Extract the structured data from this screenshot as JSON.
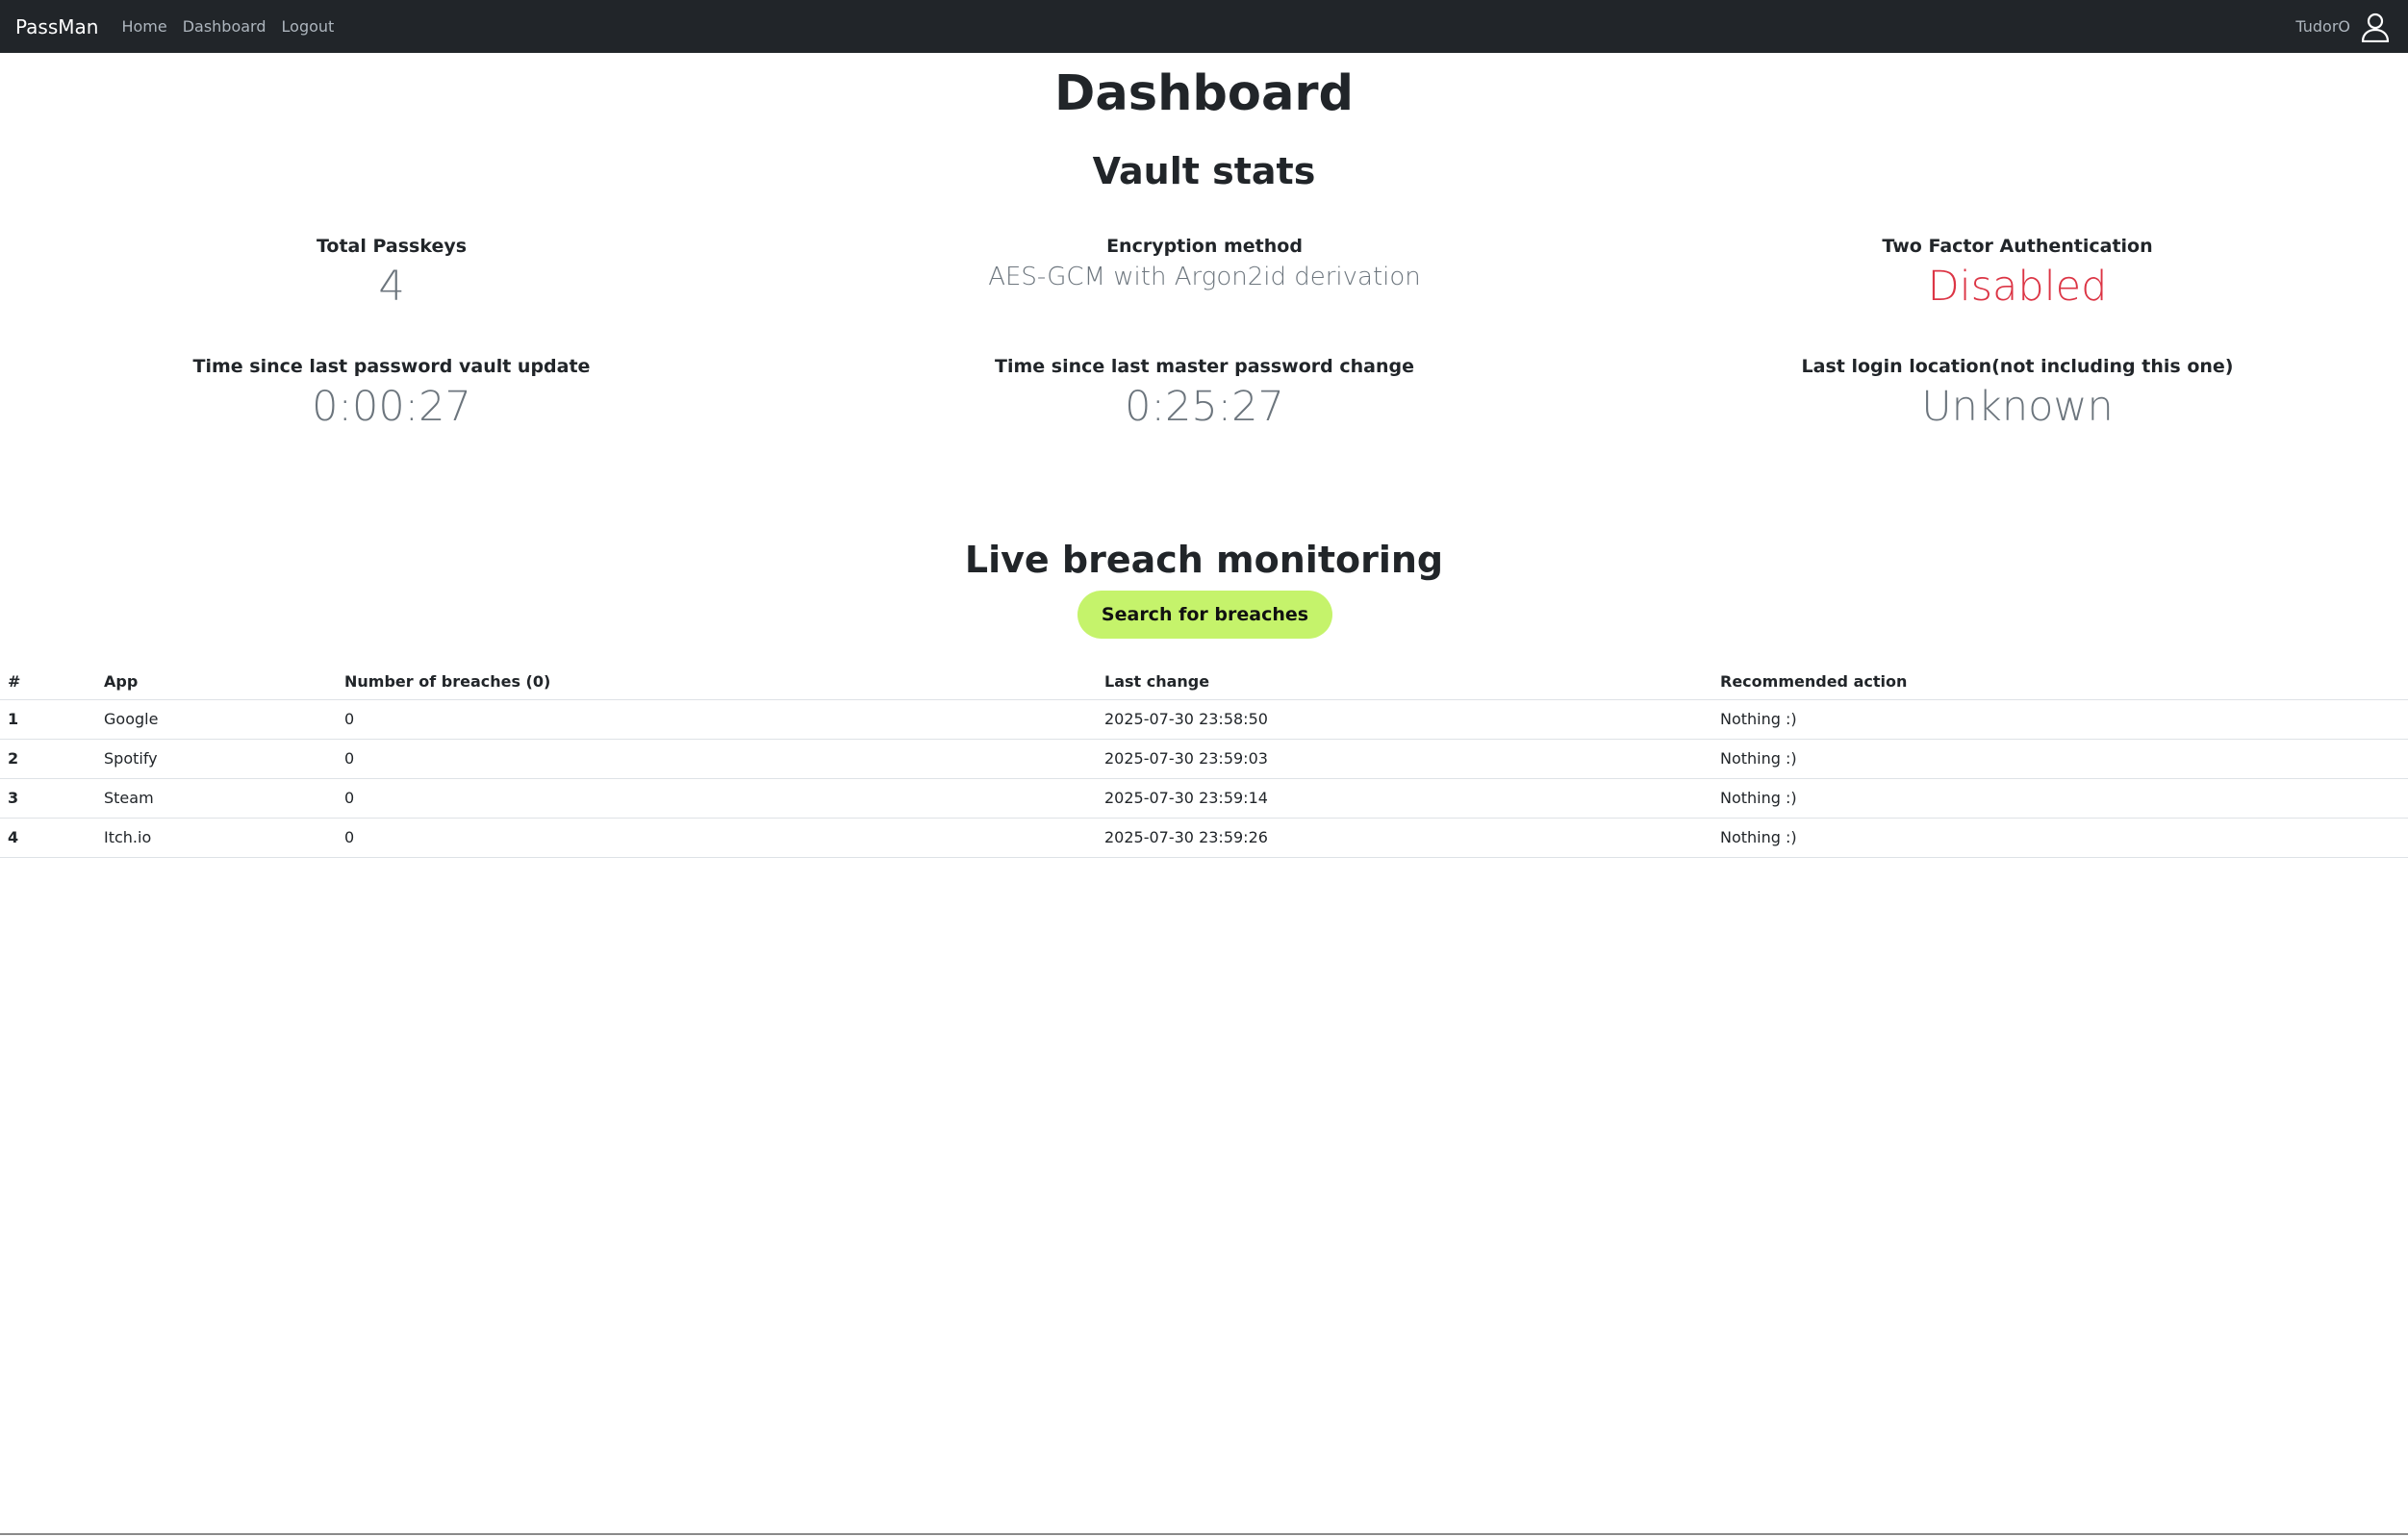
{
  "navbar": {
    "brand": "PassMan",
    "links": [
      "Home",
      "Dashboard",
      "Logout"
    ],
    "username": "TudorO",
    "user_icon": "user-icon"
  },
  "page": {
    "title": "Dashboard",
    "vault_title": "Vault stats",
    "breach_title": "Live breach monitoring"
  },
  "stats": {
    "total_passkeys": {
      "label": "Total Passkeys",
      "value": "4"
    },
    "encryption": {
      "label": "Encryption method",
      "value": "AES-GCM with Argon2id derivation"
    },
    "two_factor": {
      "label": "Two Factor Authentication",
      "value": "Disabled"
    },
    "vault_update": {
      "label": "Time since last password vault update",
      "value": "0:00:27"
    },
    "master_change": {
      "label": "Time since last master password change",
      "value": "0:25:27"
    },
    "last_login": {
      "label": "Last login location(not including this one)",
      "value": "Unknown"
    }
  },
  "breach": {
    "search_label": "Search for breaches",
    "columns": [
      "#",
      "App",
      "Number of breaches (0)",
      "Last change",
      "Recommended action"
    ],
    "rows": [
      {
        "num": "1",
        "app": "Google",
        "breaches": "0",
        "last_change": "2025-07-30 23:58:50",
        "action": "Nothing :)"
      },
      {
        "num": "2",
        "app": "Spotify",
        "breaches": "0",
        "last_change": "2025-07-30 23:59:03",
        "action": "Nothing :)"
      },
      {
        "num": "3",
        "app": "Steam",
        "breaches": "0",
        "last_change": "2025-07-30 23:59:14",
        "action": "Nothing :)"
      },
      {
        "num": "4",
        "app": "Itch.io",
        "breaches": "0",
        "last_change": "2025-07-30 23:59:26",
        "action": "Nothing :)"
      }
    ]
  },
  "colors": {
    "navbar_bg": "#212529",
    "accent_button": "#c5f36b",
    "danger": "#dc3545",
    "muted": "#6c757d"
  }
}
